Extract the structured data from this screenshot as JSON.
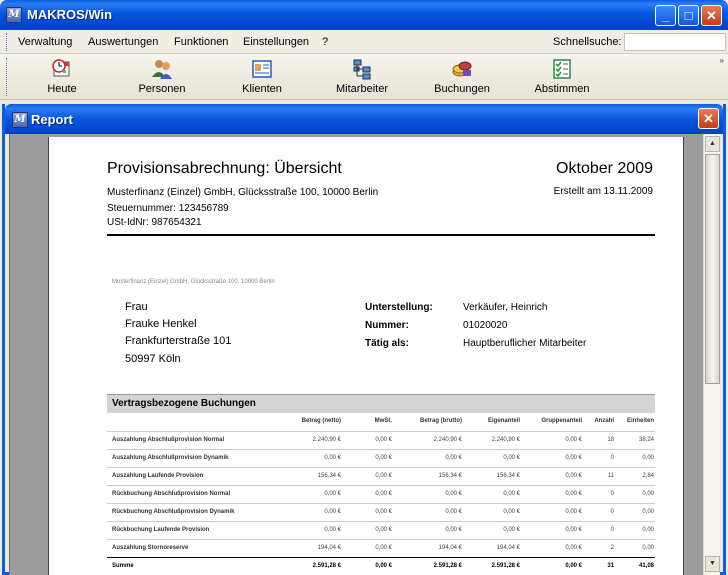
{
  "app": {
    "title": "MAKROS/Win",
    "icon_letter": "M",
    "window_buttons": {
      "minimize": "_",
      "maximize": "□",
      "close": "✕"
    }
  },
  "menu": {
    "items": [
      {
        "label": "Verwaltung"
      },
      {
        "label": "Auswertungen"
      },
      {
        "label": "Funktionen"
      },
      {
        "label": "Einstellungen"
      },
      {
        "label": "?"
      }
    ],
    "search_label": "Schnellsuche:",
    "search_value": ""
  },
  "toolbar": {
    "items": [
      {
        "label": "Heute",
        "icon": "calendar-clock-icon"
      },
      {
        "label": "Personen",
        "icon": "people-icon"
      },
      {
        "label": "Klienten",
        "icon": "id-card-icon"
      },
      {
        "label": "Mitarbeiter",
        "icon": "org-tree-icon"
      },
      {
        "label": "Buchungen",
        "icon": "coins-icon"
      },
      {
        "label": "Abstimmen",
        "icon": "checklist-icon"
      }
    ],
    "overflow": "»"
  },
  "report_window": {
    "title": "Report",
    "close": "✕"
  },
  "report": {
    "title": "Provisionsabrechnung: Übersicht",
    "period": "Oktober 2009",
    "company_line": "Musterfinanz (Einzel) GmbH, Glücksstraße 100, 10000 Berlin",
    "created": "Erstellt am 13.11.2009",
    "tax_number": "Steuernummer: 123456789",
    "vat_id": "USt-IdNr: 987654321",
    "sender_small": "Musterfinanz (Einzel) GmbH, Glücksstraße 100, 10000 Berlin",
    "recipient": {
      "salutation": "Frau",
      "name": "Frauke Henkel",
      "street": "Frankfurterstraße 101",
      "city": "50997 Köln"
    },
    "details": [
      {
        "label": "Unterstellung:",
        "value": "Verkäufer, Heinrich"
      },
      {
        "label": "Nummer:",
        "value": "01020020"
      },
      {
        "label": "Tätig als:",
        "value": "Hauptberuflicher Mitarbeiter"
      }
    ],
    "section_title": "Vertragsbezogene Buchungen",
    "columns": [
      "Betrag (netto)",
      "MwSt.",
      "Betrag (brutto)",
      "Eigenanteil",
      "Gruppenanteil",
      "Anzahl",
      "Einheiten"
    ],
    "rows": [
      {
        "name": "Auszahlung Abschlußprovision Normal",
        "values": [
          "2.240,90 €",
          "0,00 €",
          "2.240,90 €",
          "2.240,90 €",
          "0,00 €",
          "18",
          "38,24"
        ]
      },
      {
        "name": "Auszahlung Abschlußprovision Dynamik",
        "values": [
          "0,00 €",
          "0,00 €",
          "0,00 €",
          "0,00 €",
          "0,00 €",
          "0",
          "0,00"
        ]
      },
      {
        "name": "Auszahlung Laufende Provision",
        "values": [
          "156,34 €",
          "0,00 €",
          "156,34 €",
          "156,34 €",
          "0,00 €",
          "11",
          "2,84"
        ]
      },
      {
        "name": "Rückbuchung Abschlußprovision Normal",
        "values": [
          "0,00 €",
          "0,00 €",
          "0,00 €",
          "0,00 €",
          "0,00 €",
          "0",
          "0,00"
        ]
      },
      {
        "name": "Rückbuchung Abschlußprovision Dynamik",
        "values": [
          "0,00 €",
          "0,00 €",
          "0,00 €",
          "0,00 €",
          "0,00 €",
          "0",
          "0,00"
        ]
      },
      {
        "name": "Rückbuchung Laufende Provision",
        "values": [
          "0,00 €",
          "0,00 €",
          "0,00 €",
          "0,00 €",
          "0,00 €",
          "0",
          "0,00"
        ]
      },
      {
        "name": "Auszahlung Stornoreserve",
        "values": [
          "194,04 €",
          "0,00 €",
          "194,04 €",
          "194,04 €",
          "0,00 €",
          "2",
          "0,00"
        ]
      }
    ],
    "sum": {
      "name": "Summe",
      "values": [
        "2.591,28 €",
        "0,00 €",
        "2.591,28 €",
        "2.591,28 €",
        "0,00 €",
        "31",
        "41,08"
      ]
    }
  },
  "scrollbar": {
    "up": "▲",
    "down": "▼"
  }
}
